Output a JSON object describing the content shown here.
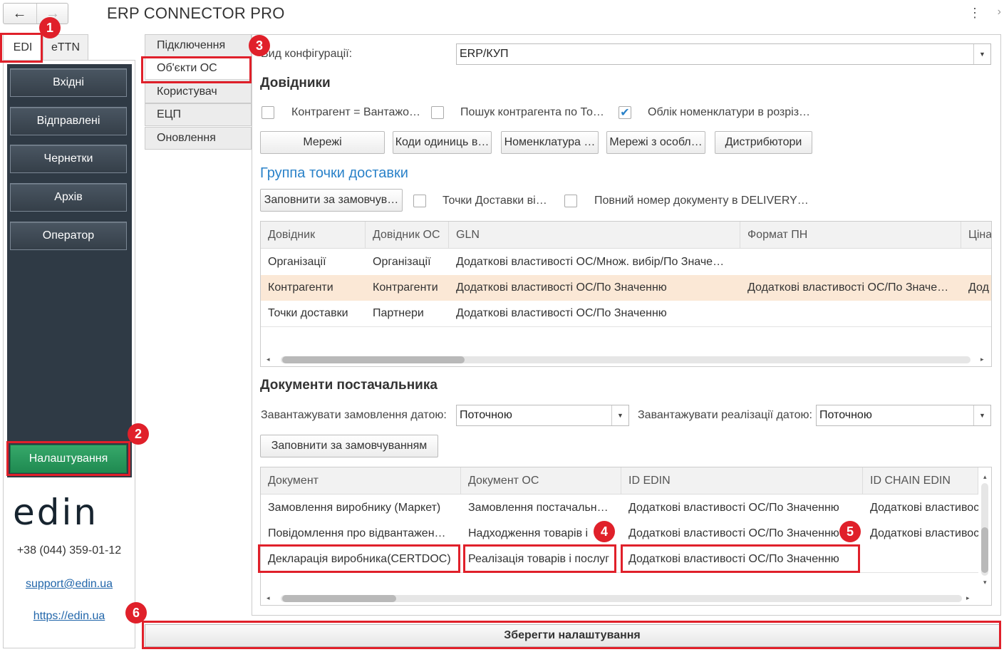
{
  "app_title": "ERP CONNECTOR PRO",
  "nav": {
    "back_icon": "←",
    "forward_icon": "→",
    "more_icon": "⋮",
    "expand_icon": "›"
  },
  "left_tabs": [
    "EDI",
    "eTTN"
  ],
  "left_nav": [
    "Вхідні",
    "Відправлені",
    "Чернетки",
    "Архів",
    "Оператор"
  ],
  "settings_button": "Налаштування",
  "brand": {
    "logo": "edin",
    "phone": "+38 (044) 359-01-12",
    "email": "support@edin.ua",
    "website": "https://edin.ua"
  },
  "settings_tabs": [
    "Підключення",
    "Об'єкти ОС",
    "Користувач",
    "ЕЦП",
    "Оновлення"
  ],
  "config": {
    "label": "Вид конфігурації:",
    "value": "ERP/КУП"
  },
  "directories": {
    "title": "Довідники",
    "checks": [
      {
        "label": "Контрагент = Вантажо…",
        "checked": false
      },
      {
        "label": "Пошук контрагента по То…",
        "checked": false
      },
      {
        "label": "Облік номенклатури в розріз…",
        "checked": true
      }
    ],
    "buttons": [
      "Мережі",
      "Коди одиниць в…",
      "Номенклатура …",
      "Мережі з особл…",
      "Дистрибютори"
    ]
  },
  "delivery": {
    "title": "Группа точки доставки",
    "fill_button": "Заповнити за замовчув…",
    "checks": [
      {
        "label": "Точки Доставки ві…",
        "checked": false
      },
      {
        "label": "Повний номер документу в DELIVERY…",
        "checked": false
      }
    ]
  },
  "ref_table": {
    "columns": [
      "Довідник",
      "Довідник ОС",
      "GLN",
      "Формат ПН",
      "Ціна"
    ],
    "rows": [
      [
        "Організації",
        "Організації",
        "Додаткові властивості ОС/Множ. вибір/По Значе…",
        "",
        ""
      ],
      [
        "Контрагенти",
        "Контрагенти",
        "Додаткові властивості ОС/По Значенню",
        "Додаткові властивості ОС/По Значе…",
        "Дод"
      ],
      [
        "Точки доставки",
        "Партнери",
        "Додаткові властивості ОС/По Значенню",
        "",
        ""
      ]
    ],
    "selected_row": 1
  },
  "supplier_docs": {
    "title": "Документи постачальника",
    "orders_label": "Завантажувати замовлення датою:",
    "orders_value": "Поточною",
    "sales_label": "Завантажувати реалізації датою:",
    "sales_value": "Поточною",
    "fill_button": "Заповнити за замовчуванням"
  },
  "docs_table": {
    "columns": [
      "Документ",
      "Документ ОС",
      "ID EDIN",
      "ID CHAIN EDIN"
    ],
    "rows": [
      [
        "Замовлення виробнику (Маркет)",
        "Замовлення постачальн…",
        "Додаткові властивості ОС/По Значенню",
        "Додаткові властивос"
      ],
      [
        "Повідомлення про відвантажен…",
        "Надходження товарів і",
        "Додаткові властивості ОС/По Значенню",
        "Додаткові властивос"
      ],
      [
        "Декларація виробника(CERTDOC)",
        "Реалізація товарів і послуг",
        "Додаткові властивості ОС/По Значенню",
        ""
      ]
    ]
  },
  "save_button": "Зберегти налаштування",
  "markers": [
    "1",
    "2",
    "3",
    "4",
    "5",
    "6"
  ],
  "colors": {
    "annotation": "#e0202a",
    "nav_bg": "#2f3a45",
    "settings_green": "#1f8a51",
    "accent_blue": "#2a82c9",
    "selected_row": "#fbe8d6"
  }
}
